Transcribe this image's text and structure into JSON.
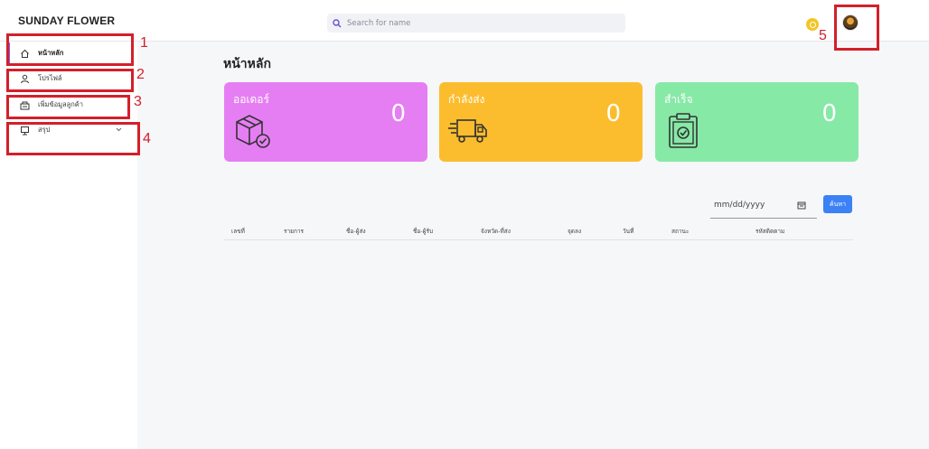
{
  "app": {
    "brand": "SUNDAY FLOWER"
  },
  "search": {
    "placeholder": "Search for name"
  },
  "sidebar": {
    "items": [
      {
        "label": "หน้าหลัก",
        "icon": "home-icon"
      },
      {
        "label": "โปรไฟล์",
        "icon": "user-icon"
      },
      {
        "label": "เพิ่มข้อมูลลูกค้า",
        "icon": "add-customer-icon"
      },
      {
        "label": "สรุป",
        "icon": "summary-icon"
      }
    ]
  },
  "main": {
    "title": "หน้าหลัก",
    "cards": [
      {
        "label": "ออเดอร์",
        "value": "0",
        "color": "#e67ef3",
        "icon": "package-icon"
      },
      {
        "label": "กำลังส่ง",
        "value": "0",
        "color": "#fbbd2d",
        "icon": "truck-icon"
      },
      {
        "label": "สำเร็จ",
        "value": "0",
        "color": "#87e9a6",
        "icon": "clipboard-check-icon"
      }
    ],
    "date_placeholder": "mm/dd/yyyy",
    "search_button": "ค้นหา",
    "table_headers": [
      "เลขที่",
      "รายการ",
      "ชื่อ-ผู้ส่ง",
      "ชื่อ-ผู้รับ",
      "จังหวัด-ที่ส่ง",
      "จุดลง",
      "วันที่",
      "สถานะ",
      "รหัสติดตาม"
    ]
  },
  "annotations": [
    "1",
    "2",
    "3",
    "4",
    "5"
  ],
  "colors": {
    "accent": "#7b5cf0",
    "button": "#3b82f6",
    "annotation": "#d3202a"
  }
}
